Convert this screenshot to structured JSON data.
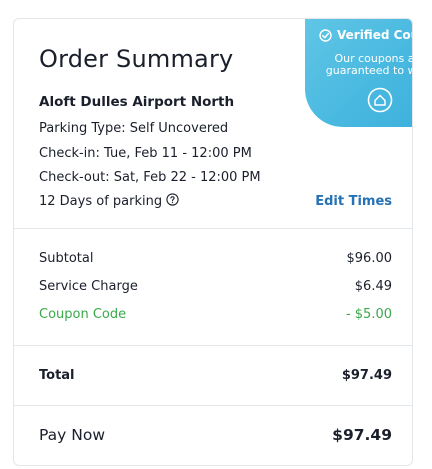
{
  "badge": {
    "title": "Verified Coupon",
    "line1": "Our coupons are",
    "line2": "guaranteed to work",
    "colors": {
      "bg": "#48b8e0",
      "text": "#ffffff"
    }
  },
  "summary": {
    "title": "Order Summary",
    "lot_name": "Aloft Dulles Airport North",
    "parking_type": "Parking Type: Self Uncovered",
    "check_in": "Check-in: Tue, Feb 11 - 12:00 PM",
    "check_out": "Check-out: Sat, Feb 22 - 12:00 PM",
    "duration": "12 Days of parking",
    "edit_label": "Edit Times"
  },
  "charges": {
    "subtotal_label": "Subtotal",
    "subtotal_value": "$96.00",
    "service_label": "Service Charge",
    "service_value": "$6.49",
    "coupon_label": "Coupon Code",
    "coupon_value": "- $5.00",
    "coupon_color": "#3aa84a"
  },
  "totals": {
    "total_label": "Total",
    "total_value": "$97.49",
    "pay_label": "Pay Now",
    "pay_value": "$97.49"
  },
  "accent": "#2572b5",
  "icons": [
    "check-circle-icon",
    "question-circle-icon",
    "verified-seal-icon"
  ]
}
